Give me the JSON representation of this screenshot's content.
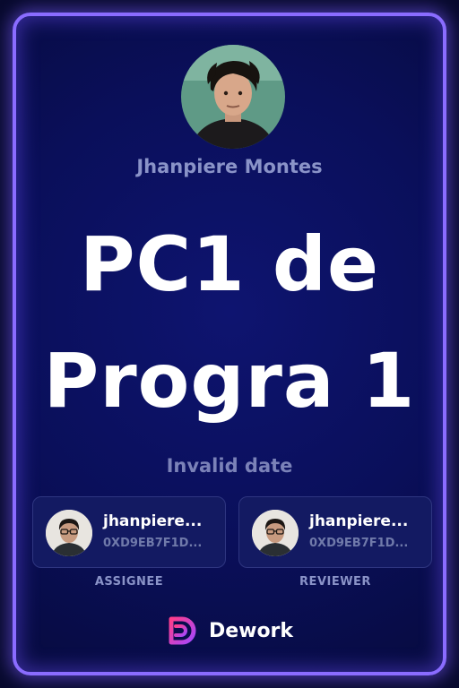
{
  "task": {
    "creator_name": "Jhanpiere Montes",
    "title": "PC1 de Progra 1",
    "date": "Invalid date"
  },
  "assignee": {
    "name": "jhanpiere...",
    "address": "0XD9EB7F1D...",
    "role_label": "ASSIGNEE"
  },
  "reviewer": {
    "name": "jhanpiere...",
    "address": "0XD9EB7F1D...",
    "role_label": "REVIEWER"
  },
  "brand": {
    "name": "Dework",
    "logo_icon": "dework-logo-icon"
  },
  "colors": {
    "background": "#0a0f5a",
    "border_glow": "#8a6cff",
    "title_text": "#ffffff",
    "muted_text": "#8a93c8"
  }
}
